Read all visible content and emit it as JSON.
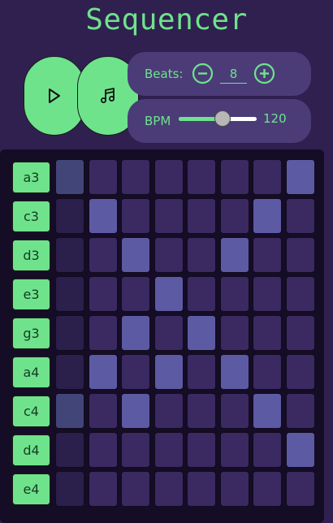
{
  "app": {
    "title": "Sequencer"
  },
  "controls": {
    "play_icon": "play-icon",
    "music_icon": "music-note-icon",
    "beats": {
      "label": "Beats:",
      "value": "8",
      "decrement_icon": "minus-circle-icon",
      "increment_icon": "plus-circle-icon"
    },
    "bpm": {
      "label": "BPM",
      "value": "120",
      "slider_min": 40,
      "slider_max": 200,
      "slider_value": 120
    }
  },
  "grid": {
    "notes": [
      "a3",
      "c3",
      "d3",
      "e3",
      "g3",
      "a4",
      "c4",
      "d4",
      "e4"
    ],
    "rows": [
      [
        2,
        0,
        0,
        0,
        0,
        0,
        0,
        1
      ],
      [
        3,
        1,
        0,
        0,
        0,
        0,
        1,
        0
      ],
      [
        3,
        0,
        1,
        0,
        0,
        1,
        0,
        0
      ],
      [
        3,
        0,
        0,
        1,
        0,
        0,
        0,
        0
      ],
      [
        3,
        0,
        1,
        0,
        1,
        0,
        0,
        0
      ],
      [
        3,
        1,
        0,
        1,
        0,
        1,
        0,
        0
      ],
      [
        2,
        0,
        1,
        0,
        0,
        0,
        1,
        0
      ],
      [
        3,
        0,
        0,
        0,
        0,
        0,
        0,
        1
      ],
      [
        3,
        0,
        0,
        0,
        0,
        0,
        0,
        0
      ]
    ]
  },
  "colors": {
    "accent": "#6ee38c",
    "background": "#30204f",
    "panel": "#4b3c78",
    "cell_off": "#3a2a61",
    "cell_on": "#5c5aa3"
  }
}
